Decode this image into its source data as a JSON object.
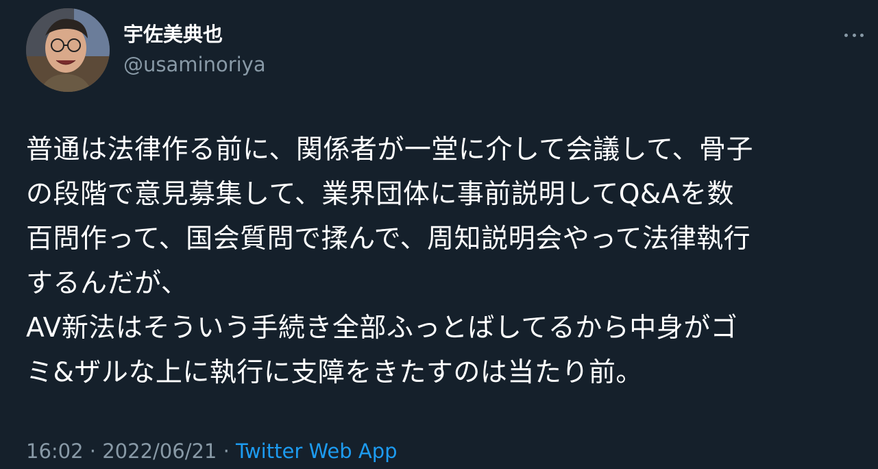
{
  "user": {
    "display_name": "宇佐美典也",
    "handle": "@usaminoriya"
  },
  "tweet": {
    "lines": [
      "普通は法律作る前に、関係者が一堂に介して会議して、骨子",
      "の段階で意見募集して、業界団体に事前説明してQ&Aを数",
      "百問作って、国会質問で揉んで、周知説明会やって法律執行",
      "するんだが、",
      "AV新法はそういう手続き全部ふっとばしてるから中身がゴ",
      "ミ&ザルな上に執行に支障をきたすのは当たり前。"
    ],
    "time": "16:02",
    "separator1": " · ",
    "date": "2022/06/21",
    "separator2": " · ",
    "source": "Twitter Web App"
  },
  "icons": {
    "more": "more-horizontal-icon",
    "avatar": "user-avatar"
  },
  "colors": {
    "background": "#15202b",
    "text": "#ffffff",
    "secondary": "#8899a6",
    "link": "#1d9bf0"
  }
}
